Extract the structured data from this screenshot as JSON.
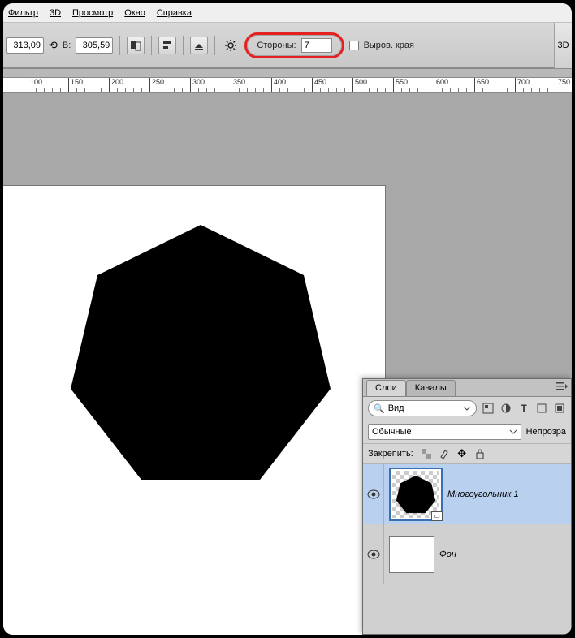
{
  "menu": {
    "filter": "Фильтр",
    "view3d": "3D",
    "review": "Просмотр",
    "window": "Окно",
    "help": "Справка"
  },
  "options": {
    "readout1": "313,09",
    "H_label": "В:",
    "readout2": "305,59",
    "sides_label": "Стороны:",
    "sides_value": "7",
    "align_label": "Выров. края",
    "threeD": "3D"
  },
  "ruler": {
    "start": 100,
    "step": 50,
    "end": 750
  },
  "panel": {
    "tabs": {
      "layers": "Слои",
      "channels": "Каналы"
    },
    "search_label": "Вид",
    "blend_mode": "Обычные",
    "opacity_label": "Непрозра",
    "lock_label": "Закрепить:",
    "layer1_name": "Многоугольник 1",
    "layer2_name": "Фон"
  }
}
